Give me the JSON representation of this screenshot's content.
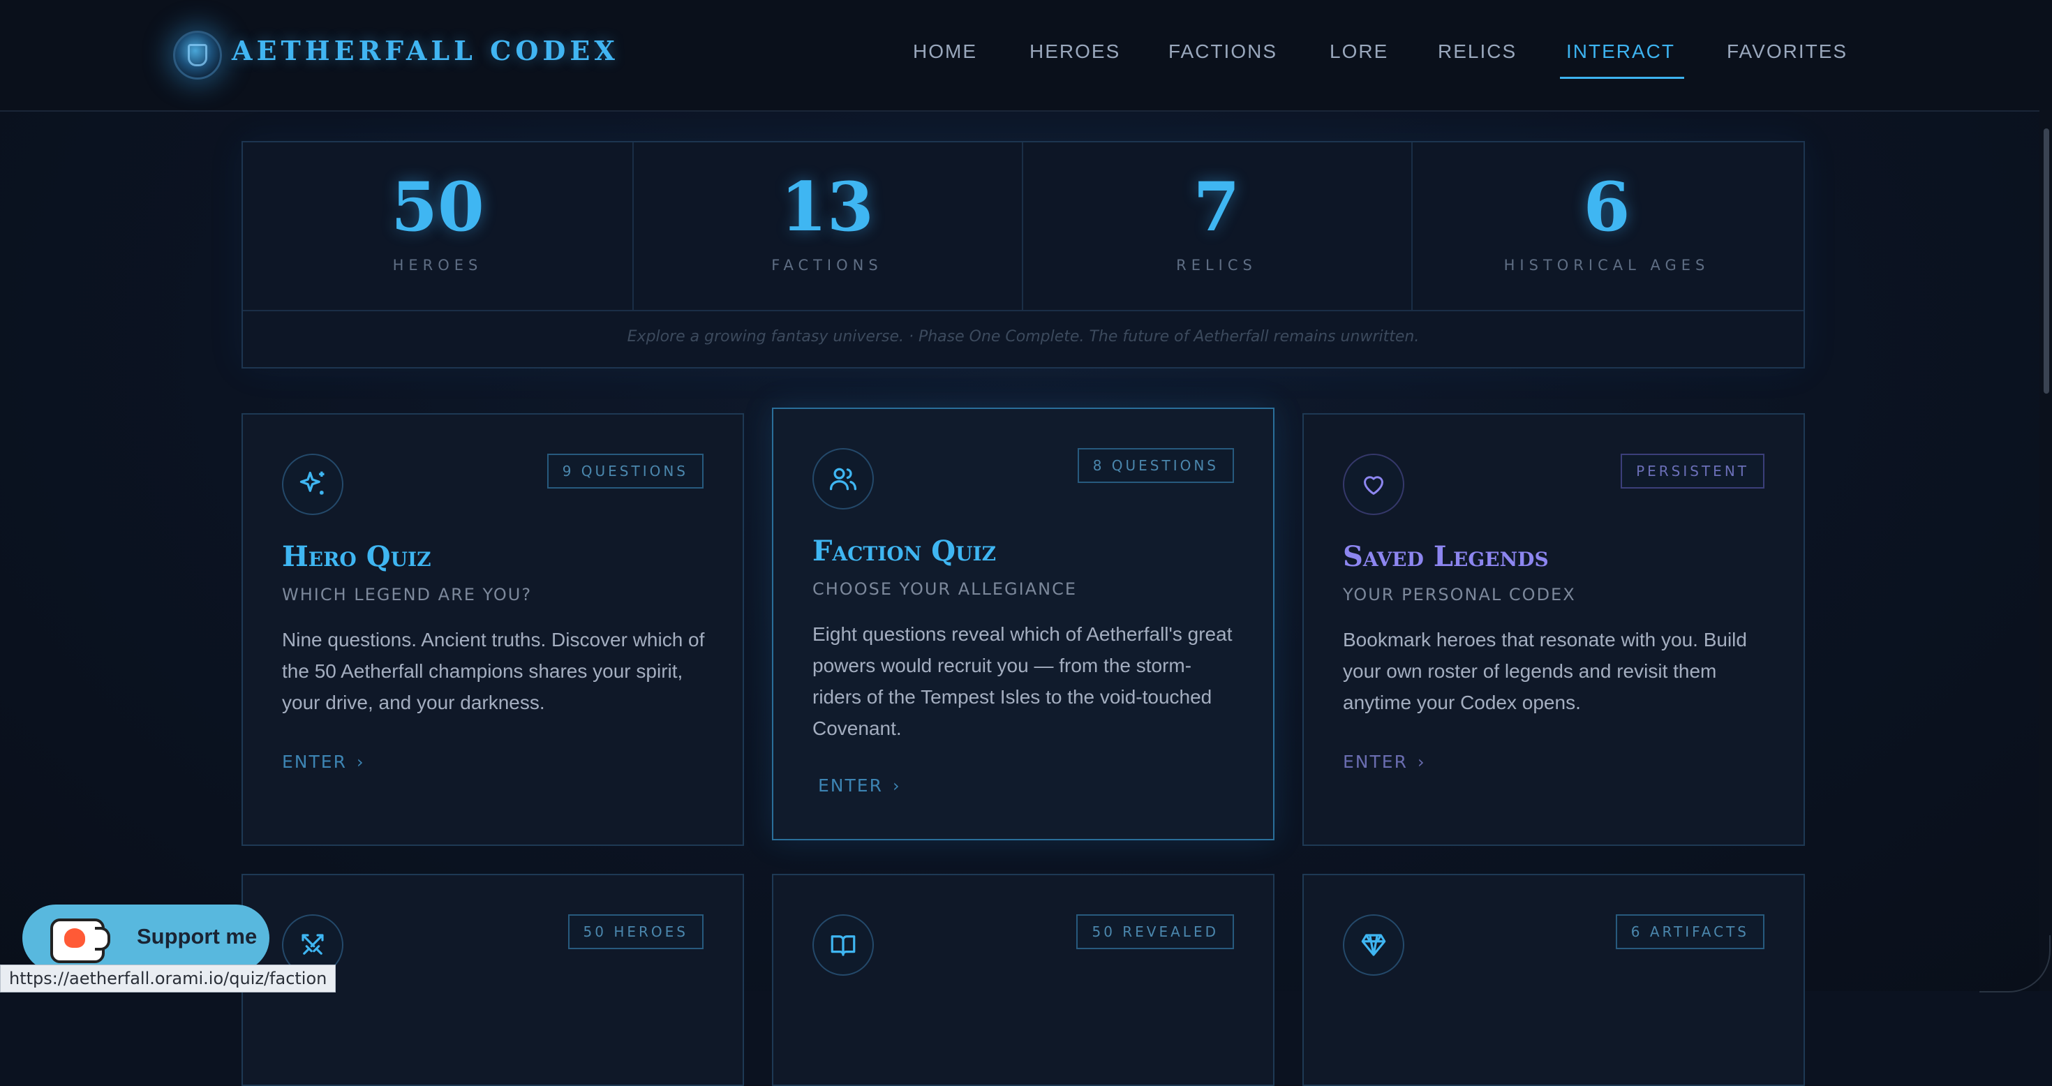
{
  "nav": {
    "brand": "AETHERFALL CODEX",
    "items": [
      {
        "label": "HOME"
      },
      {
        "label": "HEROES"
      },
      {
        "label": "FACTIONS"
      },
      {
        "label": "LORE"
      },
      {
        "label": "RELICS"
      },
      {
        "label": "INTERACT",
        "active": true
      },
      {
        "label": "FAVORITES"
      }
    ]
  },
  "stats": {
    "items": [
      {
        "value": "50",
        "label": "HEROES"
      },
      {
        "value": "13",
        "label": "FACTIONS"
      },
      {
        "value": "7",
        "label": "RELICS"
      },
      {
        "value": "6",
        "label": "HISTORICAL AGES"
      }
    ],
    "tagline": "Explore a growing fantasy universe.  ·  Phase One Complete. The future of Aetherfall remains unwritten."
  },
  "cards": [
    {
      "icon": "sparkles-icon",
      "badge": "9 QUESTIONS",
      "title": "Hero Quiz",
      "subtitle": "WHICH LEGEND ARE YOU?",
      "body": "Nine questions. Ancient truths. Discover which of the 50 Aetherfall champions shares your spirit, your drive, and your darkness.",
      "cta": "ENTER"
    },
    {
      "icon": "users-icon",
      "badge": "8 QUESTIONS",
      "title": "Faction Quiz",
      "subtitle": "CHOOSE YOUR ALLEGIANCE",
      "body": "Eight questions reveal which of Aetherfall's great powers would recruit you — from the storm-riders of the Tempest Isles to the void-touched Covenant.",
      "cta": "ENTER"
    },
    {
      "icon": "heart-icon",
      "badge": "PERSISTENT",
      "title": "Saved Legends",
      "subtitle": "YOUR PERSONAL CODEX",
      "body": "Bookmark heroes that resonate with you. Build your own roster of legends and revisit them anytime your Codex opens.",
      "cta": "ENTER"
    },
    {
      "icon": "crossed-swords-icon",
      "badge": "50 HEROES"
    },
    {
      "icon": "open-book-icon",
      "badge": "50 REVEALED"
    },
    {
      "icon": "gem-icon",
      "badge": "6 ARTIFACTS"
    }
  ],
  "colors": {
    "accent": "#3fb6f2",
    "accent_purple": "#8d86f0",
    "background": "#0b1220",
    "card_bg": "#0f1828",
    "support_button": "#58b8de"
  },
  "support": {
    "label": "Support me"
  },
  "status_bar": {
    "url": "https://aetherfall.orami.io/quiz/faction"
  }
}
